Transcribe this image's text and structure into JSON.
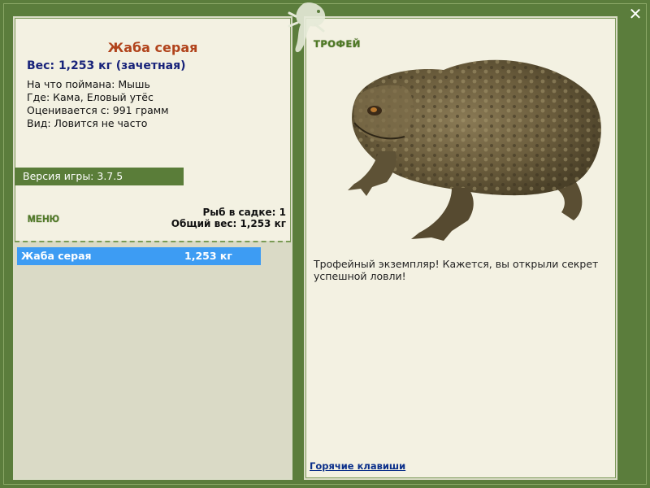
{
  "fish": {
    "name": "Жаба серая",
    "weight_line": "Вес: 1,253 кг (зачетная)",
    "caught_on": "На что поймана: Мышь",
    "where": "Где: Кама, Еловый утёс",
    "rated_from": "Оценивается с: 991 грамм",
    "kind": "Вид: Ловится не часто"
  },
  "version": "Версия игры: 3.7.5",
  "menu_label": "МЕНЮ",
  "stats": {
    "fish_in_keepnet": "Рыб в садке: 1",
    "total_weight": "Общий вес: 1,253 кг"
  },
  "catch_list": [
    {
      "name": "Жаба серая",
      "weight": "1,253 кг",
      "selected": true
    }
  ],
  "trophy": {
    "label": "ТРОФЕЙ",
    "message": "Трофейный экземпляр! Кажется, вы открыли секрет успешной ловли!"
  },
  "hotkeys_link": "Горячие клавиши",
  "close_icon": "close-icon",
  "colors": {
    "frame_green": "#5b7d3c",
    "panel_bg": "#f3f1e2",
    "title_orange": "#b1441c",
    "weight_navy": "#18237a",
    "selection_blue": "#3d9cf3"
  }
}
